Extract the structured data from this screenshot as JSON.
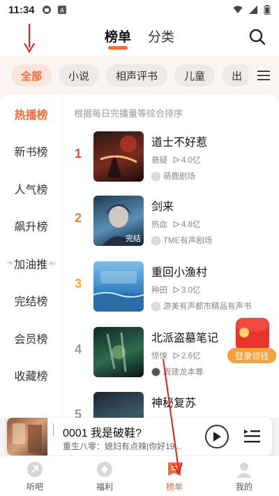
{
  "status_bar": {
    "time": "11:34"
  },
  "header": {
    "tabs": [
      {
        "label": "榜单",
        "active": true
      },
      {
        "label": "分类",
        "active": false
      }
    ],
    "search_icon": "search-icon"
  },
  "categories": [
    "全部",
    "小说",
    "相声评书",
    "儿童",
    "出"
  ],
  "sidebar": [
    "热播榜",
    "新书榜",
    "人气榜",
    "飙升榜",
    "加油推",
    "完结榜",
    "会员榜",
    "收藏榜"
  ],
  "ranking": {
    "subtitle": "根据每日完播量等综合排序",
    "items": [
      {
        "rank": "1",
        "title": "道士不好惹",
        "genre": "悬疑",
        "plays": "4.0亿",
        "publisher": "萌鹿剧场",
        "cover_tag": ""
      },
      {
        "rank": "2",
        "title": "剑来",
        "genre": "热血",
        "plays": "4.8亿",
        "publisher": "TME有声剧场",
        "cover_tag": "完结"
      },
      {
        "rank": "3",
        "title": "重回小渔村",
        "genre": "种田",
        "plays": "3.0亿",
        "publisher": "游美有声都市精品有声书",
        "cover_tag": ""
      },
      {
        "rank": "4",
        "title": "北派盗墓笔记",
        "genre": "惊悚",
        "plays": "2.6亿",
        "publisher": "周建龙本尊",
        "cover_tag": ""
      },
      {
        "rank": "5",
        "title": "神秘复苏",
        "genre": "",
        "plays": "",
        "publisher": "",
        "cover_tag": ""
      }
    ]
  },
  "promo": {
    "label": "登录领钱"
  },
  "player": {
    "title": "0001 我是破鞋?",
    "subtitle": "重生八零：媳妇有点辣|你好19..."
  },
  "bottom_nav": [
    {
      "label": "听吧",
      "active": false
    },
    {
      "label": "福利",
      "active": false
    },
    {
      "label": "榜单",
      "active": true
    },
    {
      "label": "我的",
      "active": false
    }
  ],
  "colors": {
    "accent": "#f26b3a",
    "rank1": "#e8453c",
    "rank2": "#f07a3a",
    "rank3": "#f2b21b",
    "rank_other": "#999999"
  }
}
